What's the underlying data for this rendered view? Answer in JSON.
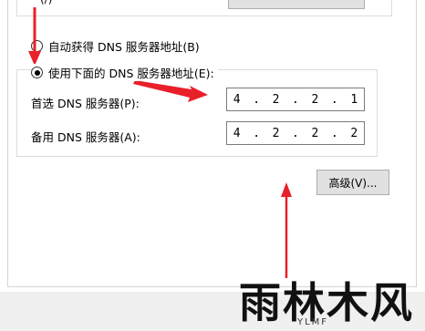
{
  "partial_top": {
    "label_fragment": "(/)"
  },
  "dns": {
    "auto_radio_label": "自动获得 DNS 服务器地址(B)",
    "manual_radio_label": "使用下面的 DNS 服务器地址(E):",
    "preferred_label": "首选 DNS 服务器(P):",
    "preferred_octets": [
      "4",
      "2",
      "2",
      "1"
    ],
    "alternate_label": "备用 DNS 服务器(A):",
    "alternate_octets": [
      "4",
      "2",
      "2",
      "2"
    ],
    "separator": "."
  },
  "advanced_button_label": "高级(V)...",
  "watermark": {
    "logo_text": "雨林木风",
    "sub_text": "YLMF"
  },
  "colors": {
    "annotation_arrow": "#e8202a"
  }
}
